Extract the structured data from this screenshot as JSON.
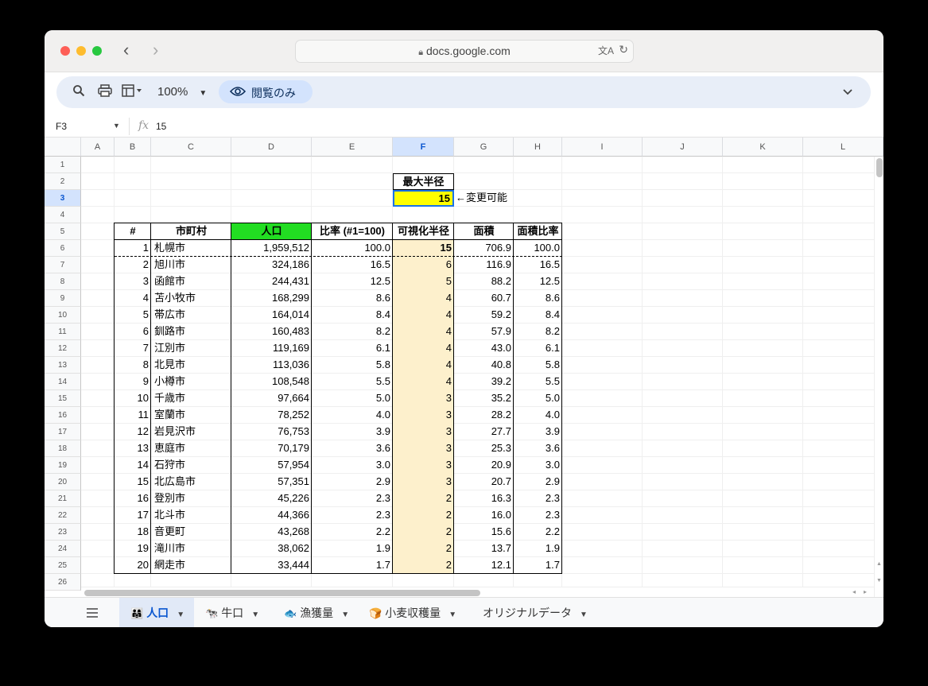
{
  "browser": {
    "url": "docs.google.com"
  },
  "toolbar": {
    "zoom": "100%",
    "view_only": "閲覧のみ"
  },
  "formula": {
    "cell_ref": "F3",
    "fx": "fx",
    "value": "15"
  },
  "columns": [
    "A",
    "B",
    "C",
    "D",
    "E",
    "F",
    "G",
    "H",
    "I",
    "J",
    "K",
    "L"
  ],
  "selected_column": "F",
  "rows": [
    "1",
    "2",
    "3",
    "4",
    "5",
    "6",
    "7",
    "8",
    "9",
    "10",
    "11",
    "12",
    "13",
    "14",
    "15",
    "16",
    "17",
    "18",
    "19",
    "20",
    "21",
    "22",
    "23",
    "24",
    "25",
    "26"
  ],
  "selected_row": "3",
  "max_radius": {
    "label": "最大半径",
    "value": "15",
    "note": "←変更可能"
  },
  "table": {
    "headers": [
      "#",
      "市町村",
      "人口",
      "比率 (#1=100)",
      "可視化半径",
      "面積",
      "面積比率"
    ],
    "rows": [
      [
        "1",
        "札幌市",
        "1,959,512",
        "100.0",
        "15",
        "706.9",
        "100.0"
      ],
      [
        "2",
        "旭川市",
        "324,186",
        "16.5",
        "6",
        "116.9",
        "16.5"
      ],
      [
        "3",
        "函館市",
        "244,431",
        "12.5",
        "5",
        "88.2",
        "12.5"
      ],
      [
        "4",
        "苫小牧市",
        "168,299",
        "8.6",
        "4",
        "60.7",
        "8.6"
      ],
      [
        "5",
        "帯広市",
        "164,014",
        "8.4",
        "4",
        "59.2",
        "8.4"
      ],
      [
        "6",
        "釧路市",
        "160,483",
        "8.2",
        "4",
        "57.9",
        "8.2"
      ],
      [
        "7",
        "江別市",
        "119,169",
        "6.1",
        "4",
        "43.0",
        "6.1"
      ],
      [
        "8",
        "北見市",
        "113,036",
        "5.8",
        "4",
        "40.8",
        "5.8"
      ],
      [
        "9",
        "小樽市",
        "108,548",
        "5.5",
        "4",
        "39.2",
        "5.5"
      ],
      [
        "10",
        "千歳市",
        "97,664",
        "5.0",
        "3",
        "35.2",
        "5.0"
      ],
      [
        "11",
        "室蘭市",
        "78,252",
        "4.0",
        "3",
        "28.2",
        "4.0"
      ],
      [
        "12",
        "岩見沢市",
        "76,753",
        "3.9",
        "3",
        "27.7",
        "3.9"
      ],
      [
        "13",
        "恵庭市",
        "70,179",
        "3.6",
        "3",
        "25.3",
        "3.6"
      ],
      [
        "14",
        "石狩市",
        "57,954",
        "3.0",
        "3",
        "20.9",
        "3.0"
      ],
      [
        "15",
        "北広島市",
        "57,351",
        "2.9",
        "3",
        "20.7",
        "2.9"
      ],
      [
        "16",
        "登別市",
        "45,226",
        "2.3",
        "2",
        "16.3",
        "2.3"
      ],
      [
        "17",
        "北斗市",
        "44,366",
        "2.3",
        "2",
        "16.0",
        "2.3"
      ],
      [
        "18",
        "音更町",
        "43,268",
        "2.2",
        "2",
        "15.6",
        "2.2"
      ],
      [
        "19",
        "滝川市",
        "38,062",
        "1.9",
        "2",
        "13.7",
        "1.9"
      ],
      [
        "20",
        "網走市",
        "33,444",
        "1.7",
        "2",
        "12.1",
        "1.7"
      ]
    ]
  },
  "colors": {
    "population_header": "#22dd22",
    "radius_col": "#fdf0cc",
    "max_radius_cell": "#ffff00",
    "accent": "#0b57d0"
  },
  "sheets": [
    {
      "icon": "👨‍👩‍👧",
      "label": "人口",
      "active": true
    },
    {
      "icon": "🐄",
      "label": "牛口",
      "active": false
    },
    {
      "icon": "🐟",
      "label": "漁獲量",
      "active": false
    },
    {
      "icon": "🍞",
      "label": "小麦収穫量",
      "active": false
    },
    {
      "icon": "",
      "label": "オリジナルデータ",
      "active": false
    }
  ]
}
